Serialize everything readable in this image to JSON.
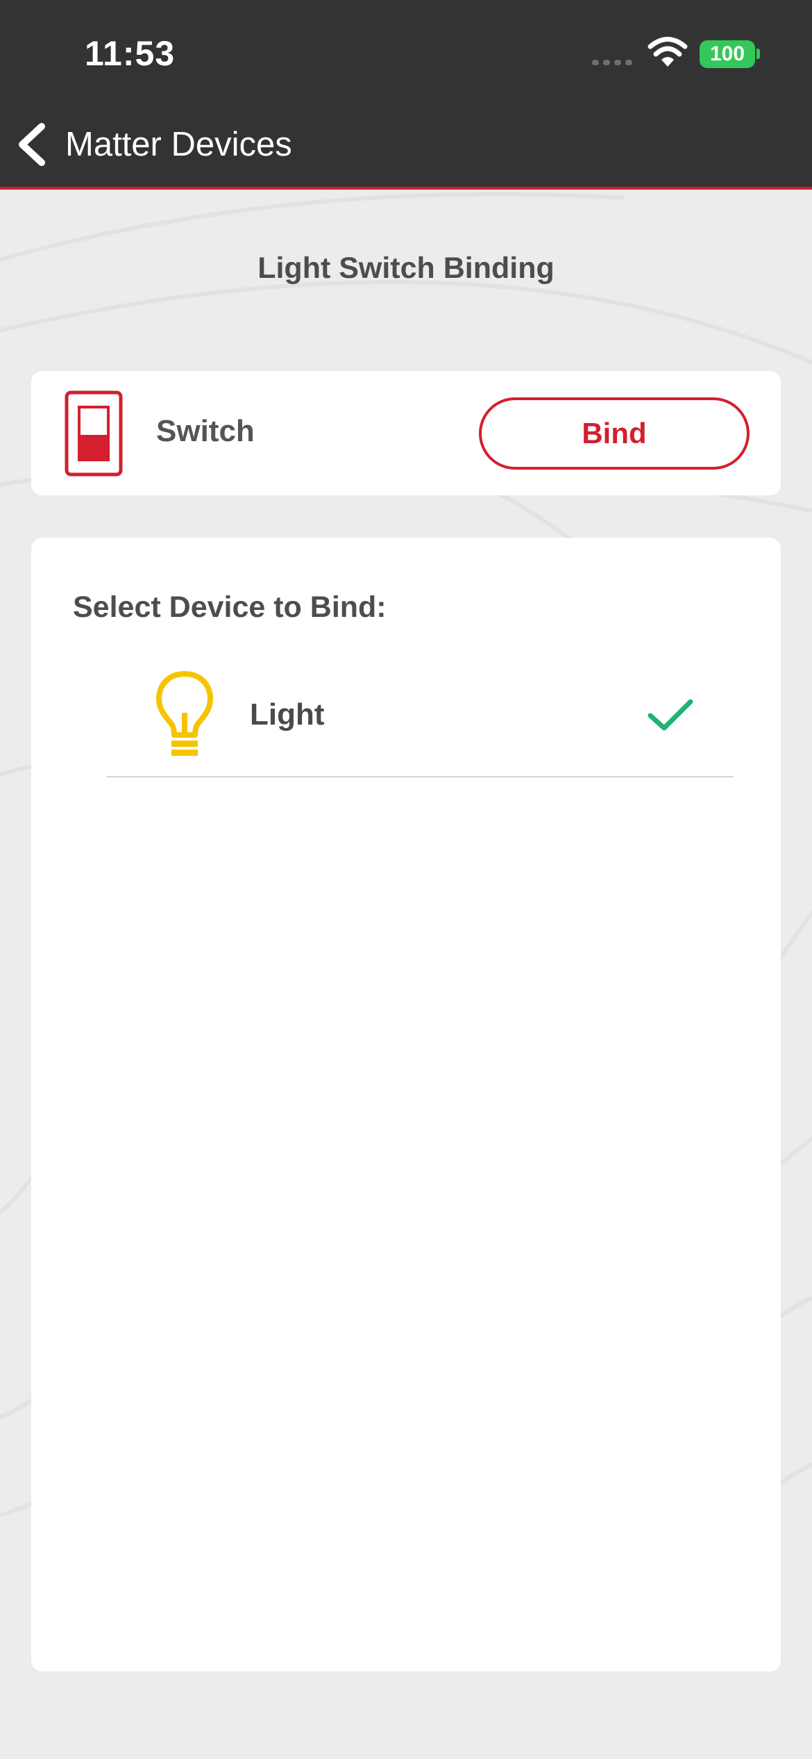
{
  "status_bar": {
    "time": "11:53",
    "battery": "100"
  },
  "nav": {
    "back_label": "Matter Devices"
  },
  "page": {
    "title": "Light Switch Binding"
  },
  "source_device": {
    "name": "Switch",
    "icon": "light-switch-icon",
    "action_label": "Bind"
  },
  "target_list": {
    "heading": "Select Device to Bind:",
    "items": [
      {
        "name": "Light",
        "icon": "light-bulb-icon",
        "selected": true
      }
    ]
  },
  "colors": {
    "header_bg": "#333333",
    "accent_red": "#d31f2e",
    "bulb_yellow": "#f5c400",
    "check_green": "#1db371",
    "battery_green": "#34c759"
  }
}
